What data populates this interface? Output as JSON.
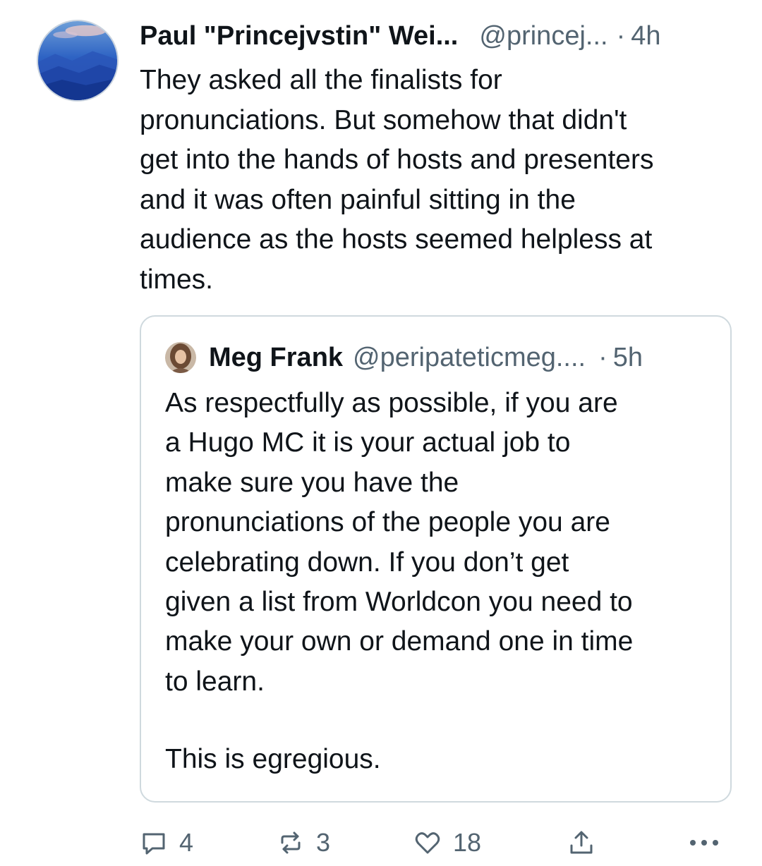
{
  "post": {
    "author_name": "Paul \"Princejvstin\" Wei...",
    "author_handle": "@princej...",
    "separator": "·",
    "time": "4h",
    "text": "They asked all the finalists for\npronunciations. But somehow that didn't\nget into the hands of hosts and presenters\nand it was often painful sitting in the\naudience as the hosts seemed helpless at\ntimes.",
    "avatar_icon": "mountain-landscape-avatar"
  },
  "quote": {
    "author_name": "Meg Frank",
    "author_handle": "@peripateticmeg....",
    "separator": "·",
    "time": "5h",
    "text": "As respectfully as possible, if you are\na Hugo MC it is your actual job to\nmake sure you have the\npronunciations of the people you are\ncelebrating down. If you don’t get\ngiven a list from Worldcon you need to\nmake your own or demand one in time\nto learn.",
    "text2": "This is egregious.",
    "avatar_icon": "person-photo-avatar"
  },
  "actions": {
    "replies": "4",
    "reposts": "3",
    "likes": "18",
    "icons": [
      "reply-icon",
      "repost-icon",
      "like-icon",
      "share-icon",
      "more-icon"
    ]
  },
  "colors": {
    "text": "#0f1419",
    "muted": "#536471",
    "border": "#cfd9de"
  }
}
